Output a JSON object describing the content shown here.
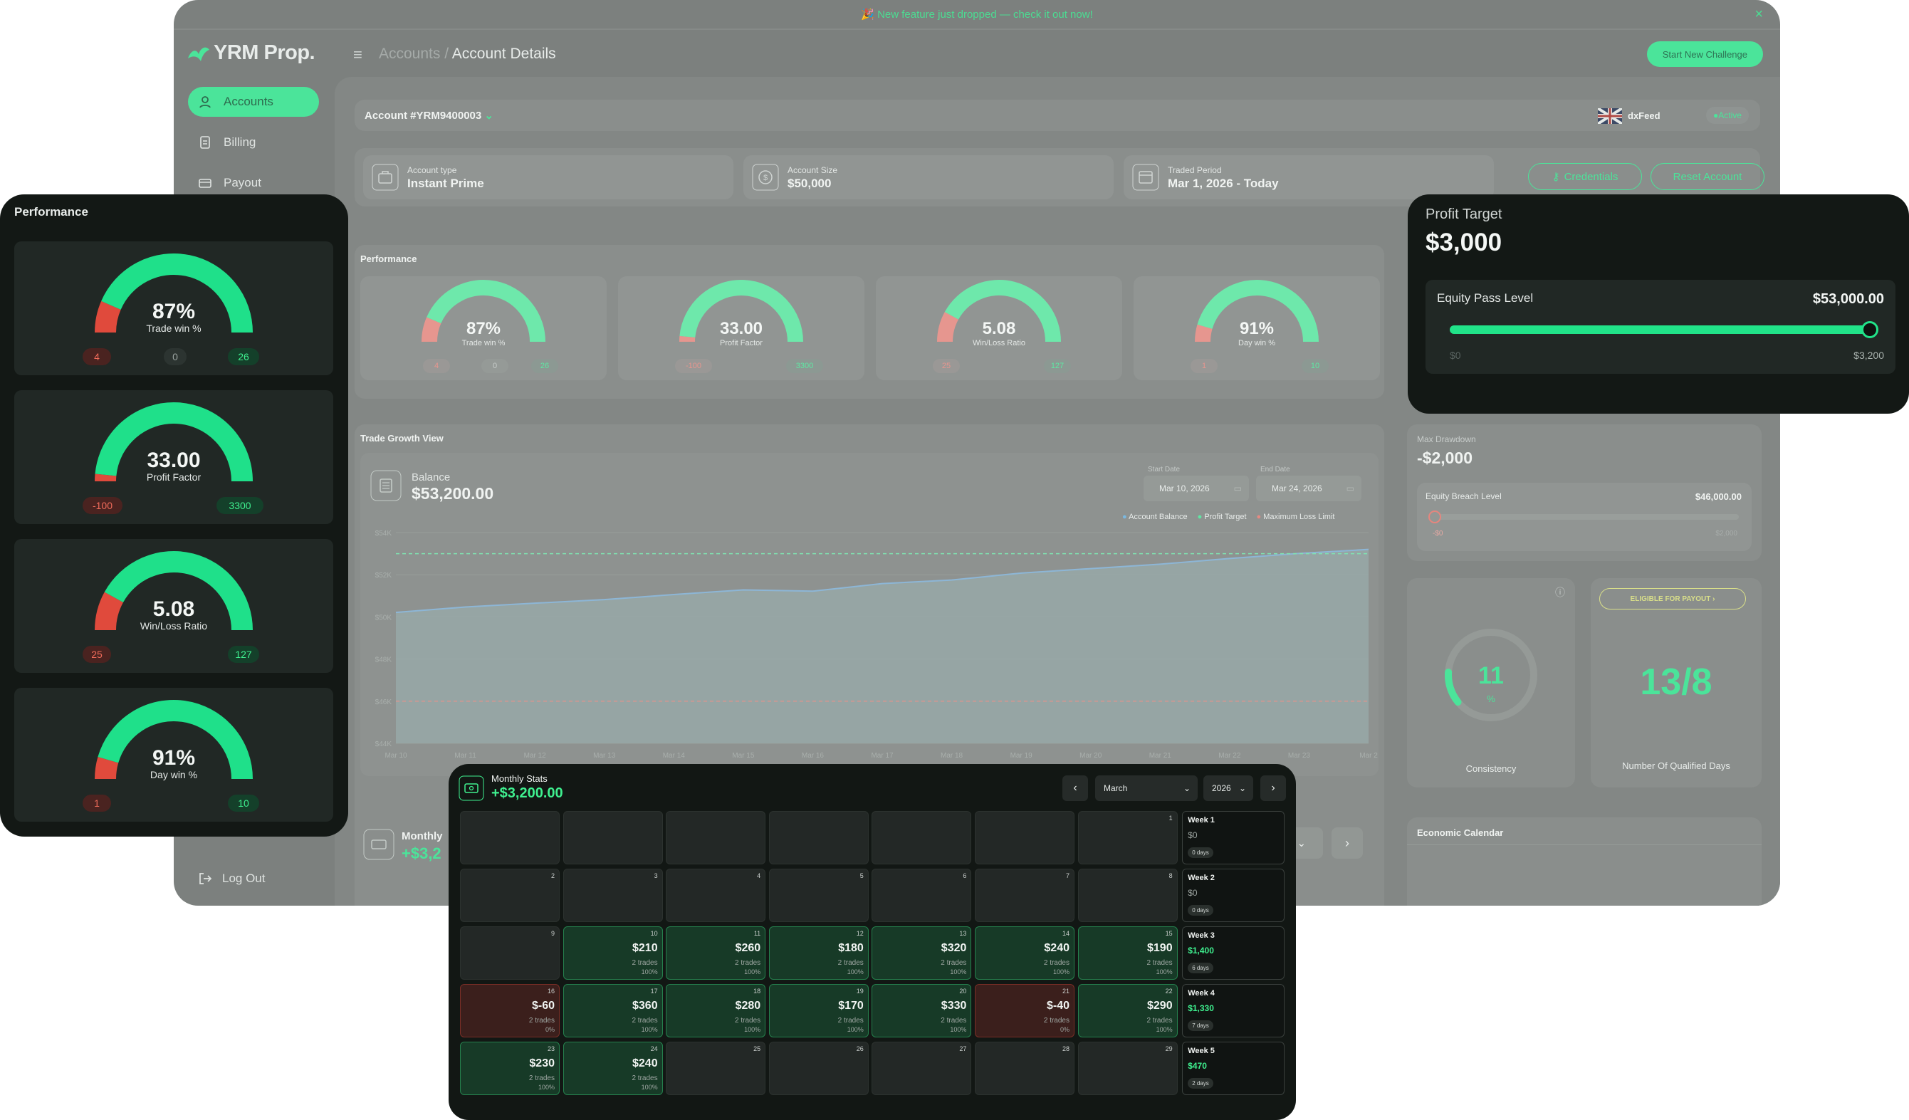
{
  "colors": {
    "accent": "#4be49a",
    "loss": "#e5584a",
    "panel": "#131815"
  },
  "banner": {
    "text": "🎉 New feature just dropped — check it out now!",
    "close": "×"
  },
  "app": {
    "logo": "YRM Prop.",
    "breadcrumb_parent": "Accounts",
    "breadcrumb_sep": "/",
    "breadcrumb_current": "Account Details",
    "new_challenge": "Start New Challenge"
  },
  "sidebar": {
    "items": [
      {
        "label": "Accounts",
        "icon": "user-icon"
      },
      {
        "label": "Billing",
        "icon": "document-icon"
      },
      {
        "label": "Payout",
        "icon": "wallet-icon"
      }
    ],
    "logout": "Log Out"
  },
  "account": {
    "id": "Account #YRM9400003",
    "platform": "dxFeed",
    "status": "Active",
    "info": [
      {
        "label": "Account type",
        "value": "Instant Prime",
        "icon": "briefcase-icon"
      },
      {
        "label": "Account Size",
        "value": "$50,000",
        "icon": "dollar-icon"
      },
      {
        "label": "Traded Period",
        "value": "Mar 1, 2026 - Today",
        "icon": "calendar-icon"
      }
    ],
    "credentials": "Credentials",
    "reset": "Reset Account"
  },
  "performance": {
    "title": "Performance",
    "gauges": [
      {
        "value": "87%",
        "label": "Trade win %",
        "left": "4",
        "mid": "0",
        "right": "26",
        "fraction": 0.87
      },
      {
        "value": "33.00",
        "label": "Profit Factor",
        "left": "-100",
        "mid": "",
        "right": "3300",
        "fraction": 0.97
      },
      {
        "value": "5.08",
        "label": "Win/Loss Ratio",
        "left": "25",
        "mid": "",
        "right": "127",
        "fraction": 0.84
      },
      {
        "value": "91%",
        "label": "Day win %",
        "left": "1",
        "mid": "",
        "right": "10",
        "fraction": 0.91
      }
    ]
  },
  "growth": {
    "title": "Trade Growth View",
    "balance_label": "Balance",
    "balance": "$53,200.00",
    "start_label": "Start Date",
    "start": "Mar 10, 2026",
    "end_label": "End Date",
    "end": "Mar 24, 2026",
    "legend": [
      "Account Balance",
      "Profit Target",
      "Maximum Loss Limit"
    ]
  },
  "chart_data": {
    "type": "area",
    "ylim": [
      44000,
      54000
    ],
    "yticks": [
      "$54K",
      "$52K",
      "$50K",
      "$48K",
      "$46K",
      "$44K"
    ],
    "xticks": [
      "Mar 10",
      "Mar 11",
      "Mar 12",
      "Mar 13",
      "Mar 14",
      "Mar 15",
      "Mar 16",
      "Mar 17",
      "Mar 18",
      "Mar 19",
      "Mar 20",
      "Mar 21",
      "Mar 22",
      "Mar 23",
      "Mar 2"
    ],
    "series": [
      {
        "name": "Account Balance",
        "values": [
          50210,
          50470,
          50650,
          50820,
          51060,
          51280,
          51220,
          51580,
          51750,
          52080,
          52290,
          52500,
          52770,
          53010,
          53200
        ]
      }
    ],
    "profit_target": 53000,
    "max_loss_limit": 46000
  },
  "profit_target": {
    "title": "Profit Target",
    "value": "$3,000",
    "pass_label": "Equity Pass Level",
    "pass_value": "$53,000.00",
    "min": "$0",
    "max": "$3,200",
    "fraction": 1.0
  },
  "drawdown": {
    "title": "Max Drawdown",
    "value": "-$2,000",
    "breach_label": "Equity Breach Level",
    "breach_value": "$46,000.00",
    "min": "-$0",
    "max": "$2,000"
  },
  "consistency": {
    "value": "11",
    "unit": "%",
    "label": "Consistency",
    "fraction": 0.11
  },
  "qualified": {
    "badge": "ELIGIBLE FOR PAYOUT",
    "value": "13/8",
    "label": "Number Of Qualified Days"
  },
  "econ": {
    "title": "Economic Calendar"
  },
  "monthly_bg": {
    "title": "Monthly",
    "value": "+$3,2",
    "year": "2026"
  },
  "monthly": {
    "title": "Monthly Stats",
    "total": "+$3,200.00",
    "month": "March",
    "year": "2026",
    "weeks": [
      {
        "label": "Week 1",
        "amount": "$0",
        "days": "0 days",
        "win": false
      },
      {
        "label": "Week 2",
        "amount": "$0",
        "days": "0 days",
        "win": false
      },
      {
        "label": "Week 3",
        "amount": "$1,400",
        "days": "6 days",
        "win": true
      },
      {
        "label": "Week 4",
        "amount": "$1,330",
        "days": "7 days",
        "win": true
      },
      {
        "label": "Week 5",
        "amount": "$470",
        "days": "2 days",
        "win": true
      }
    ],
    "rows": [
      [
        null,
        null,
        null,
        null,
        null,
        null,
        {
          "d": "1"
        }
      ],
      [
        {
          "d": "2"
        },
        {
          "d": "3"
        },
        {
          "d": "4"
        },
        {
          "d": "5"
        },
        {
          "d": "6"
        },
        {
          "d": "7"
        },
        {
          "d": "8"
        }
      ],
      [
        {
          "d": "9"
        },
        {
          "d": "10",
          "v": "$210",
          "t": "2 trades",
          "p": "100%",
          "s": "win"
        },
        {
          "d": "11",
          "v": "$260",
          "t": "2 trades",
          "p": "100%",
          "s": "win"
        },
        {
          "d": "12",
          "v": "$180",
          "t": "2 trades",
          "p": "100%",
          "s": "win"
        },
        {
          "d": "13",
          "v": "$320",
          "t": "2 trades",
          "p": "100%",
          "s": "win"
        },
        {
          "d": "14",
          "v": "$240",
          "t": "2 trades",
          "p": "100%",
          "s": "win"
        },
        {
          "d": "15",
          "v": "$190",
          "t": "2 trades",
          "p": "100%",
          "s": "win"
        }
      ],
      [
        {
          "d": "16",
          "v": "$-60",
          "t": "2 trades",
          "p": "0%",
          "s": "loss"
        },
        {
          "d": "17",
          "v": "$360",
          "t": "2 trades",
          "p": "100%",
          "s": "win"
        },
        {
          "d": "18",
          "v": "$280",
          "t": "2 trades",
          "p": "100%",
          "s": "win"
        },
        {
          "d": "19",
          "v": "$170",
          "t": "2 trades",
          "p": "100%",
          "s": "win"
        },
        {
          "d": "20",
          "v": "$330",
          "t": "2 trades",
          "p": "100%",
          "s": "win"
        },
        {
          "d": "21",
          "v": "$-40",
          "t": "2 trades",
          "p": "0%",
          "s": "loss"
        },
        {
          "d": "22",
          "v": "$290",
          "t": "2 trades",
          "p": "100%",
          "s": "win"
        }
      ],
      [
        {
          "d": "23",
          "v": "$230",
          "t": "2 trades",
          "p": "100%",
          "s": "win"
        },
        {
          "d": "24",
          "v": "$240",
          "t": "2 trades",
          "p": "100%",
          "s": "win"
        },
        {
          "d": "25"
        },
        {
          "d": "26"
        },
        {
          "d": "27"
        },
        {
          "d": "28"
        },
        {
          "d": "29"
        }
      ]
    ]
  }
}
